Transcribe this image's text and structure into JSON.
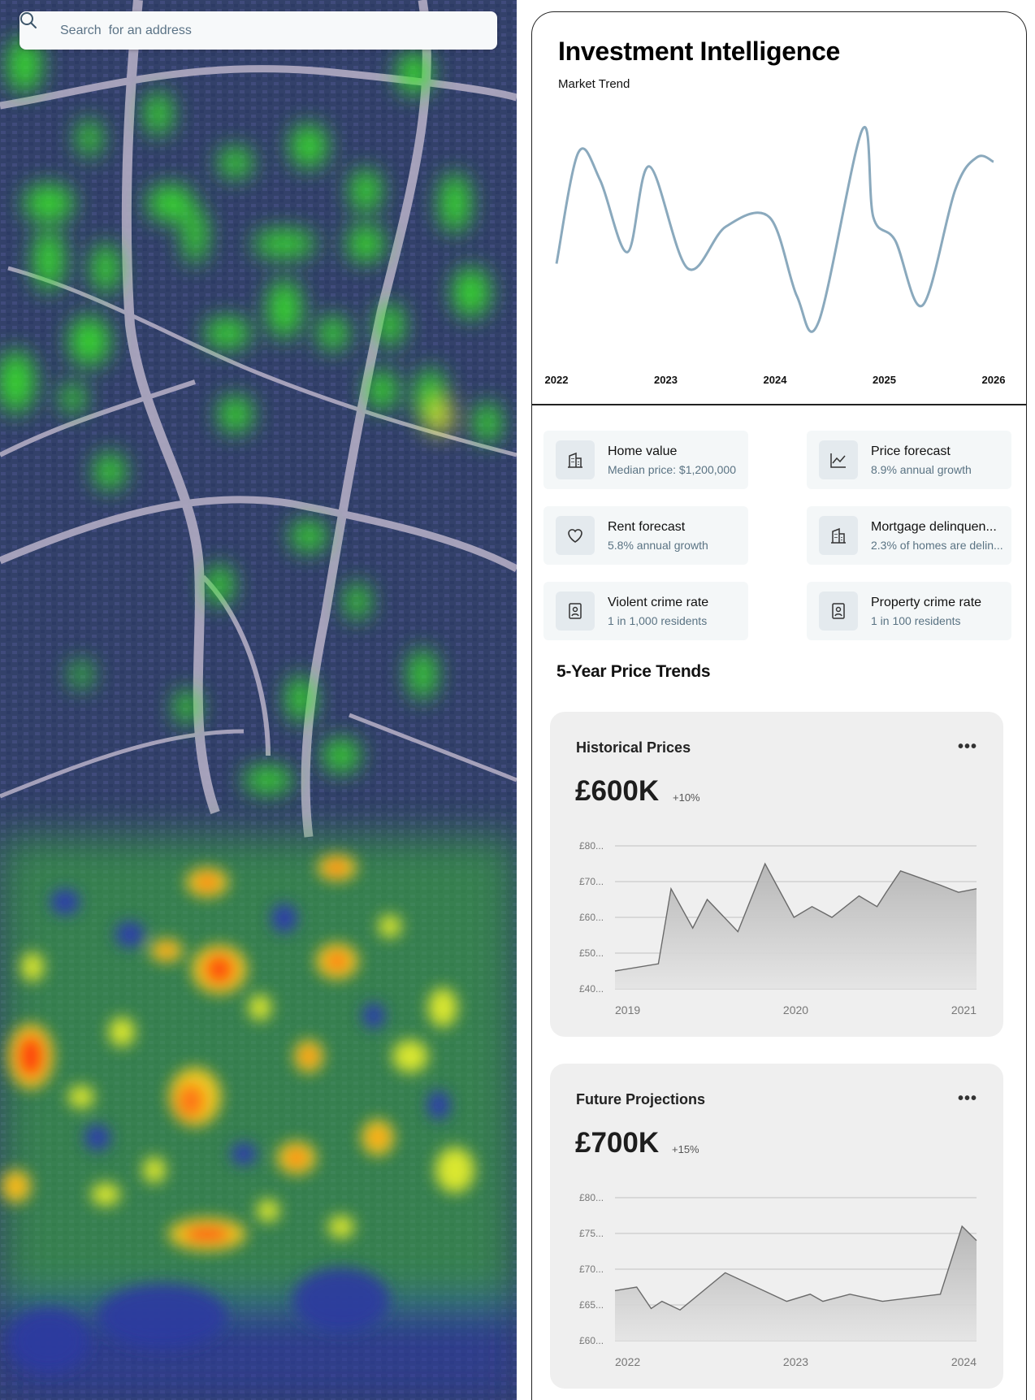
{
  "search": {
    "placeholder": "Search  for an address"
  },
  "panel": {
    "title": "Investment Intelligence",
    "market_trend_label": "Market Trend",
    "market_trend_years": [
      "2022",
      "2023",
      "2024",
      "2025",
      "2026"
    ]
  },
  "metrics": [
    {
      "title": "Home value",
      "subtitle": "Median price: $1,200,000",
      "icon": "building-icon"
    },
    {
      "title": "Price forecast",
      "subtitle": "8.9% annual growth",
      "icon": "line-chart-icon"
    },
    {
      "title": "Rent forecast",
      "subtitle": "5.8% annual growth",
      "icon": "heart-icon"
    },
    {
      "title": "Mortgage delinquen...",
      "subtitle": "2.3% of homes are delin...",
      "icon": "building-icon"
    },
    {
      "title": "Violent crime rate",
      "subtitle": "1 in 1,000 residents",
      "icon": "badge-icon"
    },
    {
      "title": "Property crime rate",
      "subtitle": "1 in 100 residents",
      "icon": "badge-icon"
    }
  ],
  "section_heading": "5-Year Price Trends",
  "cards": [
    {
      "title": "Historical Prices",
      "value": "£600K",
      "change": "+10%"
    },
    {
      "title": "Future Projections",
      "value": "£700K",
      "change": "+15%"
    }
  ],
  "colors": {
    "trend_line": "#8aa9bd",
    "card_bg": "#efefef",
    "metric_bg": "#f4f7f8",
    "subtitle": "#5a7383"
  },
  "chart_data": [
    {
      "type": "line",
      "title": "Market Trend",
      "x_ticks": [
        "2022",
        "2023",
        "2024",
        "2025",
        "2026"
      ],
      "x": [
        2022.0,
        2022.2,
        2022.4,
        2022.65,
        2022.85,
        2023.2,
        2023.55,
        2023.95,
        2024.2,
        2024.4,
        2024.8,
        2024.9,
        2025.1,
        2025.35,
        2025.65,
        2025.85,
        2026.0
      ],
      "values": [
        30,
        78,
        66,
        35,
        72,
        28,
        46,
        50,
        16,
        5,
        88,
        50,
        40,
        12,
        62,
        76,
        74
      ],
      "ylim": [
        0,
        100
      ]
    },
    {
      "type": "area",
      "title": "Historical Prices",
      "y_ticks": [
        "£80...",
        "£70...",
        "£60...",
        "£50...",
        "£40..."
      ],
      "x_ticks": [
        "2019",
        "2020",
        "2021"
      ],
      "ylim": [
        40,
        80
      ],
      "x": [
        2019.0,
        2019.24,
        2019.31,
        2019.43,
        2019.51,
        2019.68,
        2019.83,
        2019.99,
        2020.09,
        2020.2,
        2020.35,
        2020.45,
        2020.5,
        2020.58,
        2020.8,
        2020.9,
        2021.0
      ],
      "values": [
        45,
        47,
        68,
        57,
        65,
        56,
        75,
        60,
        63,
        60,
        66,
        63,
        67,
        73,
        69,
        67,
        68
      ]
    },
    {
      "type": "area",
      "title": "Future Projections",
      "y_ticks": [
        "£80...",
        "£75...",
        "£70...",
        "£65...",
        "£60..."
      ],
      "x_ticks": [
        "2022",
        "2023",
        "2024"
      ],
      "ylim": [
        60,
        80
      ],
      "x": [
        2022.0,
        2022.12,
        2022.2,
        2022.26,
        2022.36,
        2022.61,
        2022.95,
        2023.08,
        2023.15,
        2023.3,
        2023.48,
        2023.8,
        2023.92,
        2024.0
      ],
      "values": [
        67,
        67.5,
        64.5,
        65.5,
        64.3,
        69.5,
        65.5,
        66.5,
        65.5,
        66.5,
        65.5,
        66.5,
        76,
        74
      ]
    }
  ]
}
